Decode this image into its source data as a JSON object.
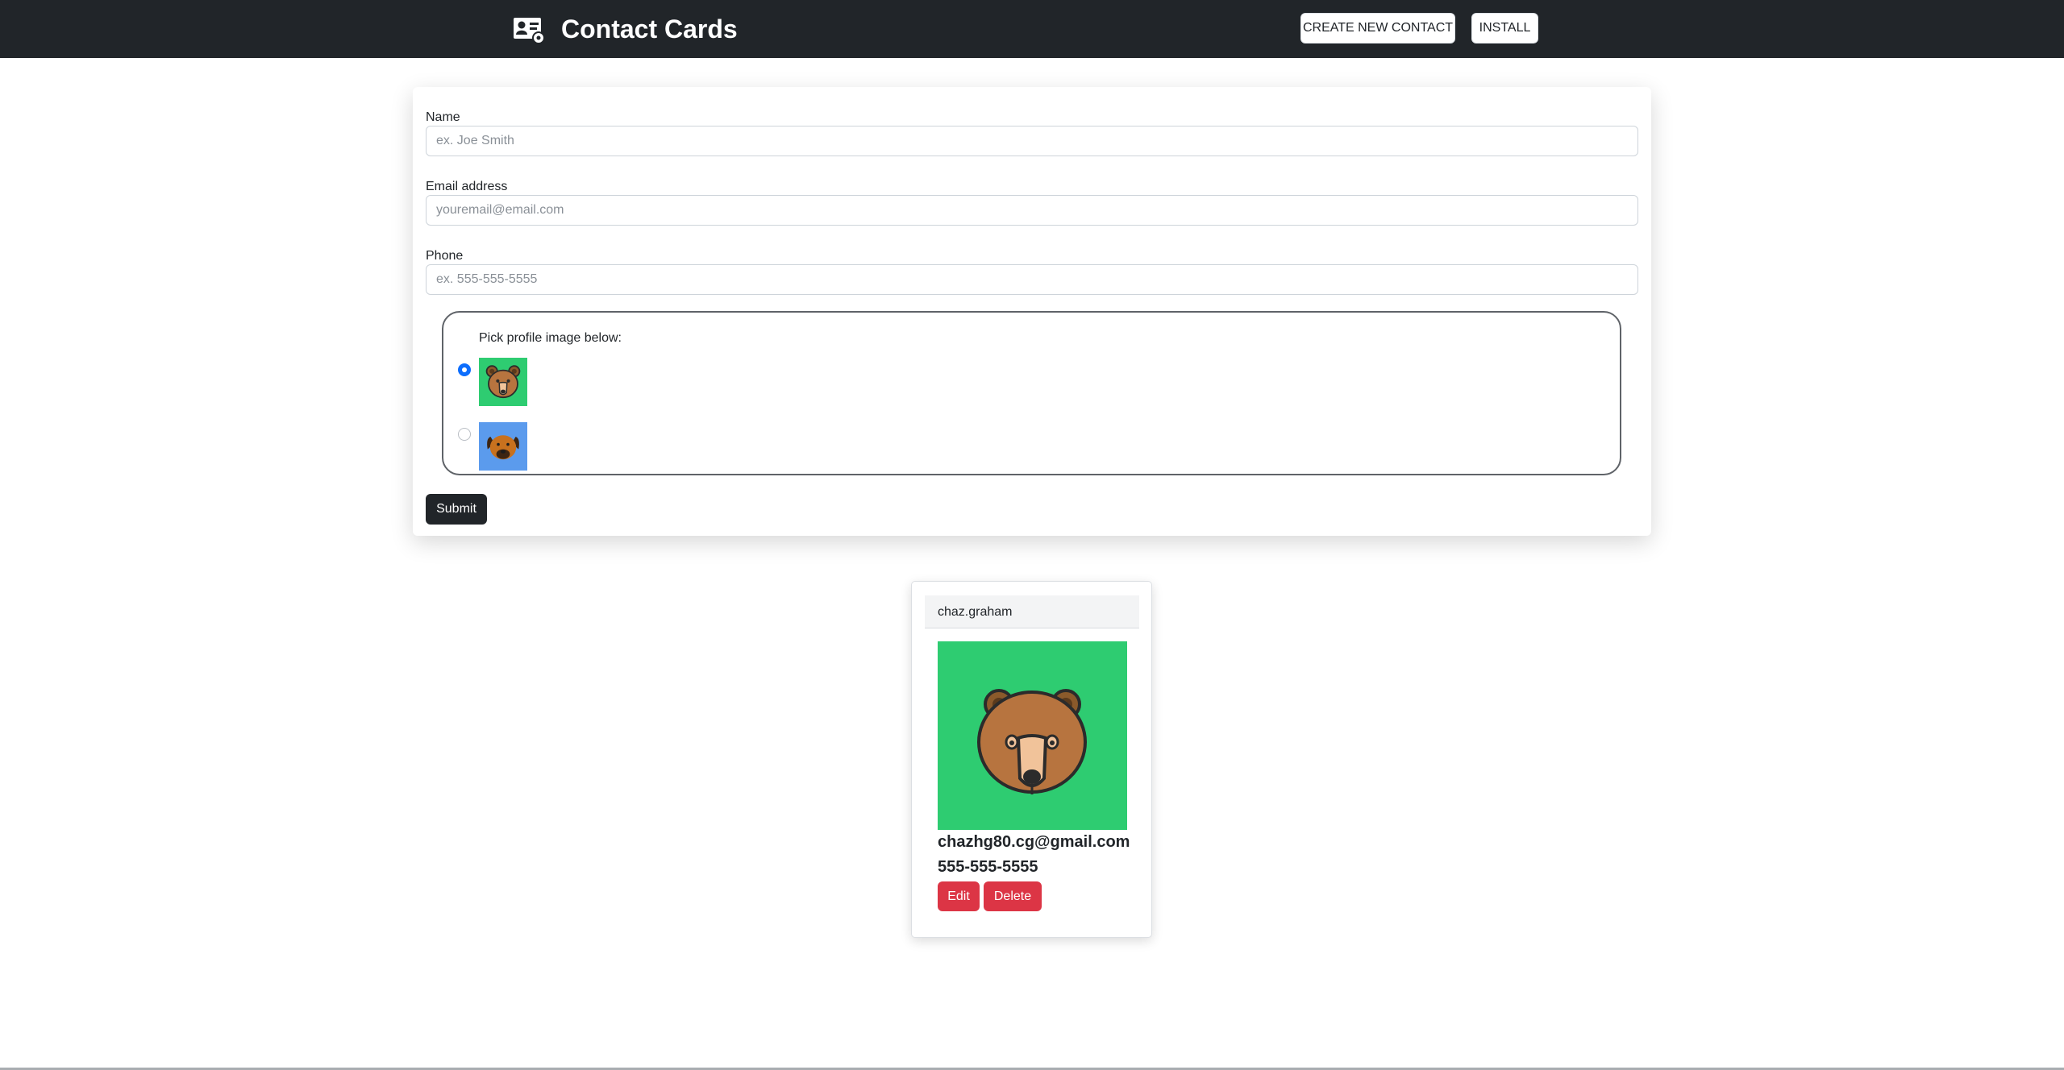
{
  "navbar": {
    "title": "Contact Cards",
    "icon": "contact-card-icon",
    "create_label": "CREATE NEW CONTACT",
    "install_label": "INSTALL",
    "background": "#212529"
  },
  "form": {
    "name_label": "Name",
    "name_value": "",
    "name_placeholder": "ex. Joe Smith",
    "email_label": "Email address",
    "email_value": "",
    "email_placeholder": "youremail@email.com",
    "phone_label": "Phone",
    "phone_value": "",
    "phone_placeholder": "ex. 555-555-5555",
    "picker_label": "Pick profile image below:",
    "profile_options": [
      {
        "icon": "bear-icon",
        "background": "#2ecc71",
        "selected": true
      },
      {
        "icon": "dog-icon",
        "background": "#5b9bed",
        "selected": false
      }
    ],
    "submit_label": "Submit"
  },
  "contacts": [
    {
      "name": "chaz.graham",
      "email": "chazhg80.cg@gmail.com",
      "phone": "555-555-5555",
      "image_icon": "bear-icon",
      "image_background": "#2ecc71",
      "edit_label": "Edit",
      "delete_label": "Delete"
    }
  ],
  "colors": {
    "danger": "#dc3545",
    "primary": "#0d6efd",
    "dark": "#212529"
  }
}
